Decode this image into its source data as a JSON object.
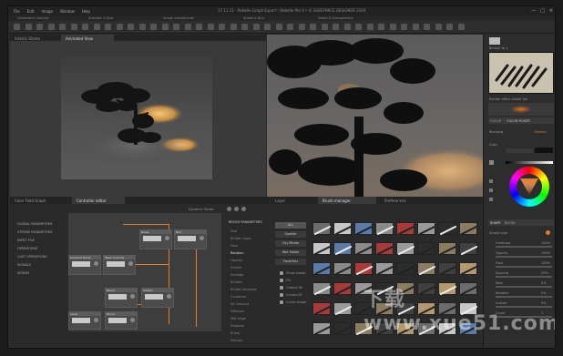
{
  "window": {
    "menu": [
      "File",
      "Edit",
      "Image",
      "Window",
      "Help"
    ],
    "title": "17.11.11 - Rebelle Graph Export - Rebelle Pro 3 • © SUBSTANCE DESIGNER 2019",
    "controls": [
      "—",
      "□",
      "✕"
    ]
  },
  "toolgroups": [
    "Generative Controls",
    "Strength & Size",
    "Image Adjustments",
    "Stroke & Blur",
    "Depth & Transparency"
  ],
  "toolbar": {
    "icon_count": 40
  },
  "top_tabs": {
    "left": [
      "Artistic Stroke",
      "Animated View"
    ],
    "right": []
  },
  "right_panel": {
    "preview_title": "Bitrazil Ya 1",
    "preview_caption": "Render effect stroke tile",
    "swatch_name": "Sandstone Cross-Hatchery",
    "tabs": [
      "COLOR",
      "COLOR PICKER"
    ],
    "section_label": "Blending",
    "section_value": "Normal",
    "color_label": "Color",
    "color_hex": "#FF6B1E",
    "opacity_label": "Opacity",
    "params_tabs": [
      "SHAPE",
      "BLEND"
    ],
    "shape_label": "Stroke type",
    "params": [
      {
        "label": "Hardness",
        "value": "100%"
      },
      {
        "label": "Opacity",
        "value": "100%"
      },
      {
        "label": "Flow",
        "value": "100%"
      },
      {
        "label": "Spacing",
        "value": "25%"
      },
      {
        "label": "Jitter",
        "value": "0%"
      },
      {
        "label": "Rotation",
        "value": "0%"
      },
      {
        "label": "Scatter",
        "value": "0%"
      },
      {
        "label": "Count",
        "value": "1"
      }
    ]
  },
  "bottom_left": {
    "tabs": [
      "Color Field Graph",
      "Controller editor"
    ],
    "side_items": [
      "GLOBAL PARAMETERS",
      "STROKE PARAMETERS",
      "INPUT FILE",
      "OPERATIONS",
      "CAST OPERATIONS",
      "SIGNALS",
      "WORKS"
    ],
    "graph_header": "Dynamic Stroke",
    "right_header": "BRUSH PARAMETERS",
    "right_items": [
      "Size",
      "Bristle Count",
      "Flow",
      "Rotation",
      "Opacity",
      "Scatter",
      "Smudge",
      "Bristles",
      "Bristle Hardness",
      "Curvature",
      "Ink Amount",
      "Diffusion",
      "Wet Edge",
      "Pressure",
      "Brush",
      "Density"
    ],
    "nodes": [
      {
        "title": "Noise"
      },
      {
        "title": "Blur"
      },
      {
        "title": "Gradient Ramp"
      },
      {
        "title": "Warp Controls"
      },
      {
        "title": "Blend"
      },
      {
        "title": "Output"
      },
      {
        "title": "Level"
      },
      {
        "title": "Brush"
      }
    ]
  },
  "bottom_right": {
    "tabs": [
      "Layer",
      "Brush manager",
      "Preferences"
    ],
    "categories": [
      "ALL",
      "Spatter",
      "Dry Media",
      "Wet Media",
      "Favorites"
    ],
    "filters": [
      {
        "label": "Show stamp",
        "checked": true
      },
      {
        "label": "Fill",
        "checked": true
      },
      {
        "label": "Outline fill",
        "checked": true
      },
      {
        "label": "Curves fill",
        "checked": true
      },
      {
        "label": "Curve shape",
        "checked": true
      }
    ],
    "brush_count": 48
  },
  "watermark": "下载 www.xue51.com"
}
